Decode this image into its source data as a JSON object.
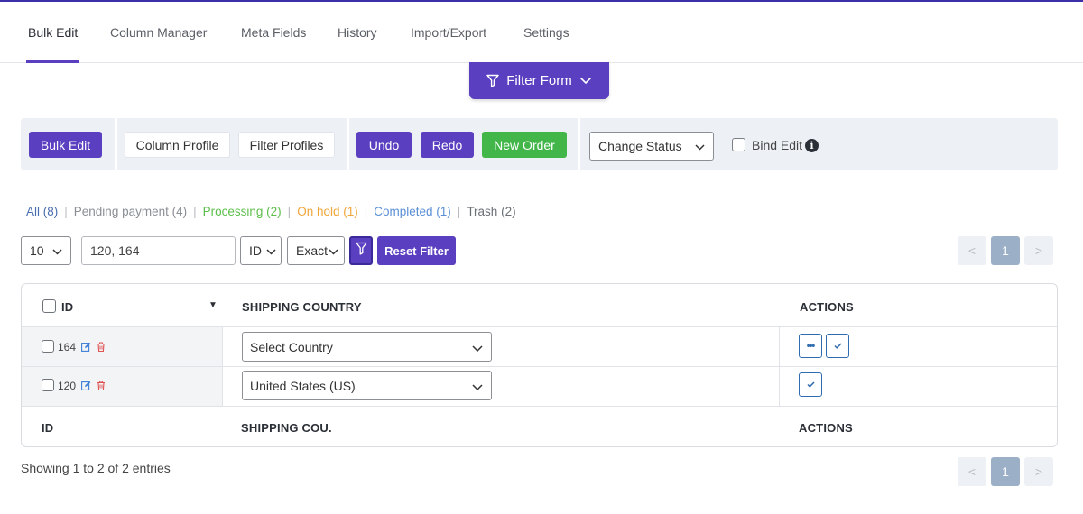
{
  "tabs": [
    {
      "label": "Bulk Edit",
      "active": true
    },
    {
      "label": "Column Manager"
    },
    {
      "label": "Meta Fields"
    },
    {
      "label": "History"
    },
    {
      "label": "Import/Export"
    },
    {
      "label": "Settings"
    }
  ],
  "filter_form": {
    "label": "Filter Form"
  },
  "toolbar": {
    "bulk_edit": "Bulk Edit",
    "column_profile": "Column Profile",
    "filter_profiles": "Filter Profiles",
    "undo": "Undo",
    "redo": "Redo",
    "new_order": "New Order",
    "change_status": "Change Status",
    "bind_edit": "Bind Edit",
    "bind_edit_checked": false
  },
  "status_filters": [
    {
      "label": "All (8)",
      "color": "#4a6fb0"
    },
    {
      "label": "Pending payment (4)",
      "color": "#8a8f96"
    },
    {
      "label": "Processing (2)",
      "color": "#5cbf4a"
    },
    {
      "label": "On hold (1)",
      "color": "#f0a63a"
    },
    {
      "label": "Completed (1)",
      "color": "#5b8fd6"
    },
    {
      "label": "Trash (2)",
      "color": "#6a6f76"
    }
  ],
  "filter_bar": {
    "per_page": "10",
    "search_value": "120, 164",
    "field": "ID",
    "match": "Exact",
    "reset_label": "Reset Filter"
  },
  "pagination": {
    "prev": "<",
    "current": "1",
    "next": ">"
  },
  "table": {
    "headers": {
      "id": "ID",
      "country": "SHIPPING COUNTRY",
      "actions": "ACTIONS",
      "sort_arrow": "▼"
    },
    "rows": [
      {
        "id": "164",
        "country": "Select Country"
      },
      {
        "id": "120",
        "country": "United States (US)"
      }
    ],
    "footers": {
      "id": "ID",
      "country": "SHIPPING COU.",
      "actions": "ACTIONS"
    }
  },
  "footer": {
    "entries_text": "Showing 1 to 2 of 2 entries"
  },
  "colors": {
    "accent": "#5a3fc0",
    "success": "#42b649",
    "link_blue": "#2e6bb0"
  }
}
